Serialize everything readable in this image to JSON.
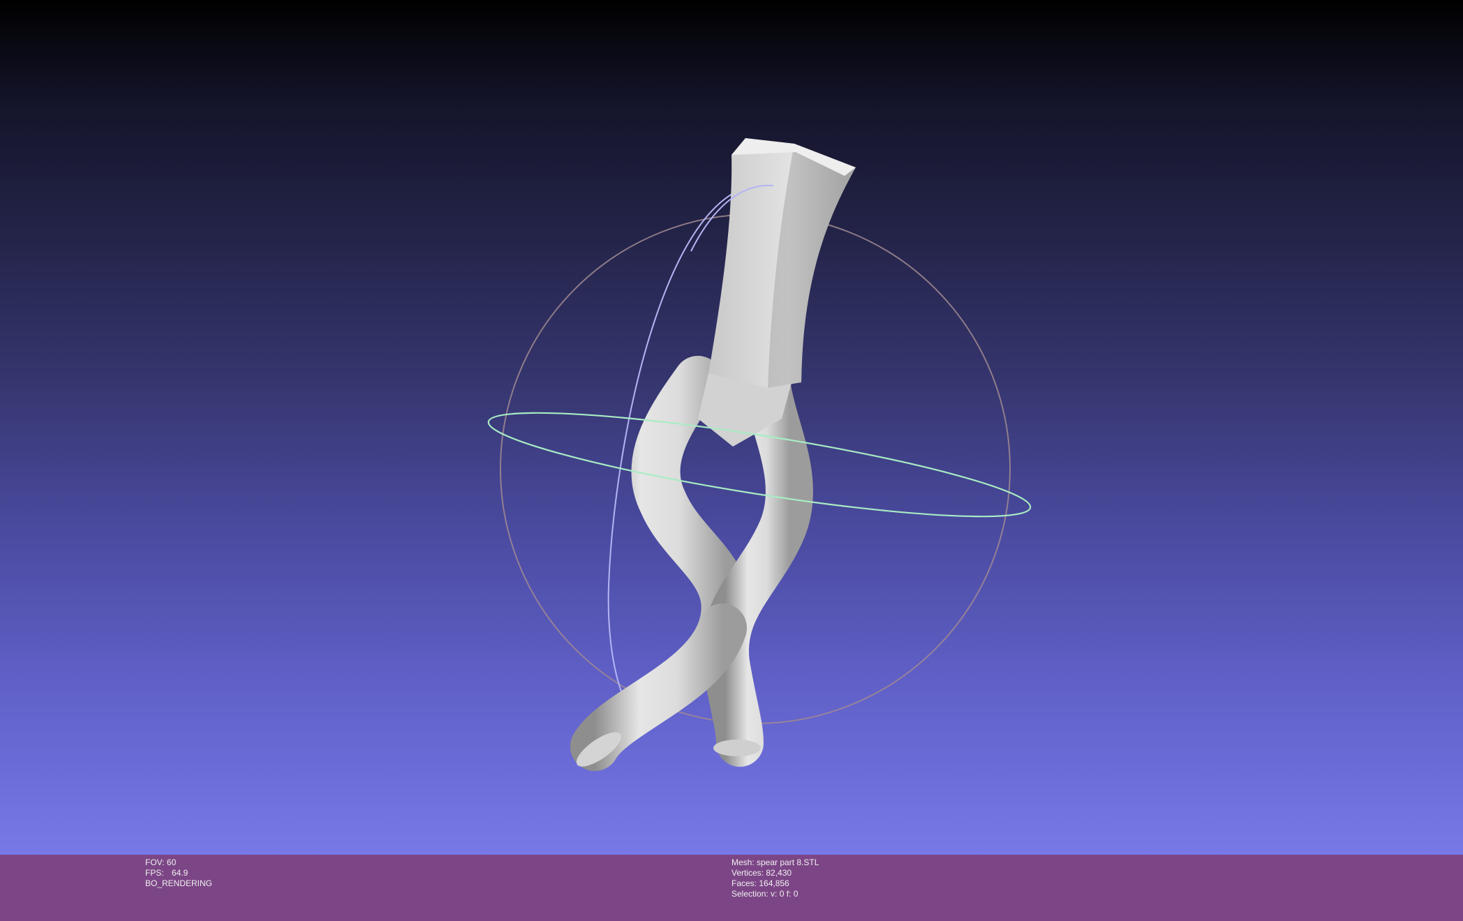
{
  "viewport": {
    "stats_left": {
      "fov_label": "FOV:",
      "fov_value": "60",
      "fps_label": "FPS:",
      "fps_value": "64.9",
      "render_mode": "BO_RENDERING"
    },
    "stats_right": {
      "mesh": "Mesh: spear part 8.STL",
      "vertices": "Vertices: 82,430",
      "faces": "Faces: 164,856",
      "selection": "Selection: v: 0 f: 0"
    }
  },
  "colors": {
    "background_top": "#000000",
    "background_bottom": "#7878e8",
    "infobar": "#7c4686",
    "mesh_light": "#e8e8e8",
    "mesh_shadow": "#9a9a9a",
    "trackball_horizontal": "#a8f0c0",
    "trackball_vertical": "#b0b0f0",
    "trackball_outer": "#b09090"
  }
}
